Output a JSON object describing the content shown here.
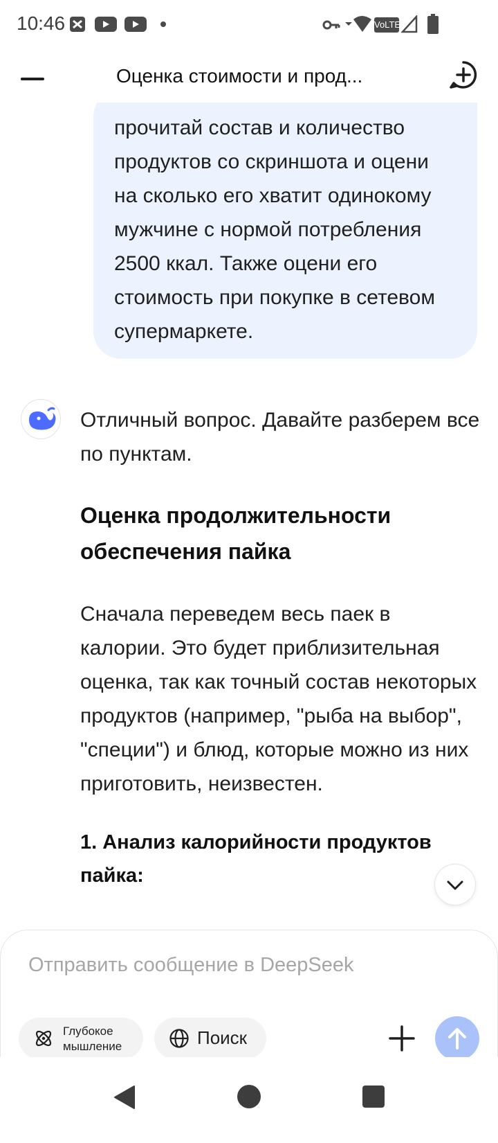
{
  "status_bar": {
    "time": "10:46",
    "icons": [
      "notification-app-icon",
      "youtube-icon",
      "youtube-icon",
      "dot-icon",
      "vpn-key-icon",
      "wifi-icon",
      "volte-icon",
      "signal-icon",
      "battery-icon"
    ],
    "volte_label": "VoLTE"
  },
  "header": {
    "title": "Оценка стоимости и прод...",
    "menu_icon": "menu-icon",
    "new_chat_icon": "new-chat-icon"
  },
  "chat": {
    "user_message": "прочитай состав и количество продуктов со скриншота и оцени на сколько его хватит одинокому мужчине с нормой потребления 2500 ккал. Также оцени его стоимость при покупке в сетевом супермаркете.",
    "assistant": {
      "avatar_icon": "deepseek-whale-icon",
      "intro": "Отличный вопрос. Давайте разберем все по пунктам.",
      "heading": "Оценка продолжительности обеспечения пайка",
      "paragraph": "Сначала переведем весь паек в калории. Это будет приблизительная оценка, так как точный состав некоторых продуктов (например, \"рыба на выбор\", \"специи\") и блюд, которые можно из них приготовить, неизвестен.",
      "subheading": "1. Анализ калорийности продуктов пайка:"
    },
    "scroll_down_icon": "chevron-down-icon"
  },
  "composer": {
    "placeholder": "Отправить сообщение в DeepSeek",
    "value": "",
    "deep_thinking_label": "Глубокое мышление",
    "search_label": "Поиск",
    "deep_thinking_icon": "atom-icon",
    "search_icon": "globe-icon",
    "attach_icon": "plus-icon",
    "send_icon": "arrow-up-icon"
  },
  "colors": {
    "user_bubble": "#edf3fe",
    "send_button": "#a9c3fa",
    "brand_blue": "#4d6bfe",
    "chip_bg": "#f3f3f3"
  }
}
